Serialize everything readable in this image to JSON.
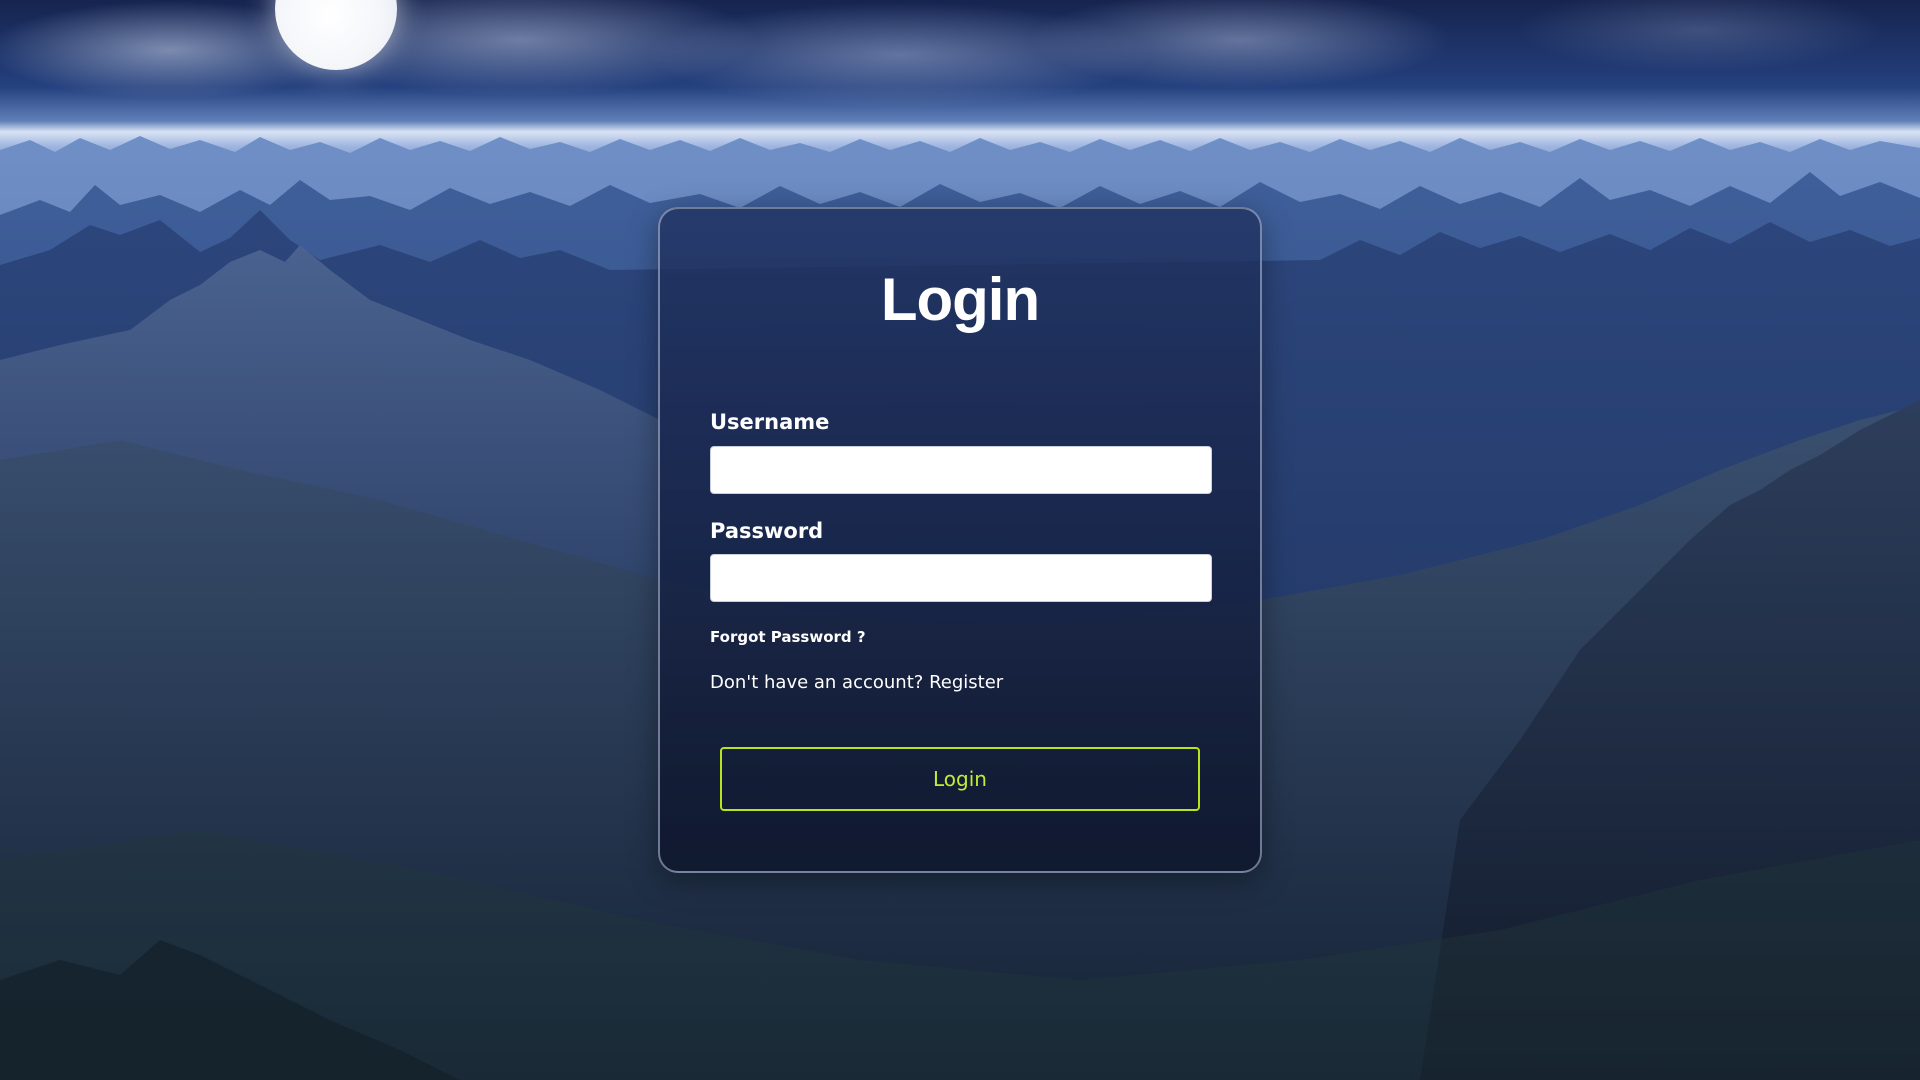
{
  "login_form": {
    "title": "Login",
    "username_label": "Username",
    "username_value": "",
    "password_label": "Password",
    "password_value": "",
    "forgot_password": "Forgot Password ?",
    "register_prompt": "Don't have an account?",
    "register_link": "Register",
    "submit_label": "Login"
  },
  "colors": {
    "card_border": "#bec8e1",
    "button_accent": "#b9e21f",
    "text": "#ffffff"
  }
}
